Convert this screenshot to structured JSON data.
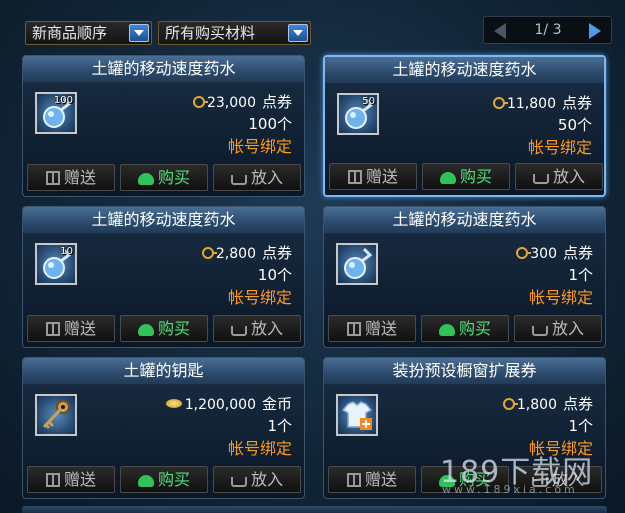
{
  "filters": {
    "sort_label": "新商品顺序",
    "material_label": "所有购买材料"
  },
  "pager": {
    "text": "1/ 3"
  },
  "buttons": {
    "gift": "赠送",
    "buy": "购买",
    "cart": "放入"
  },
  "items": [
    {
      "title": "土罐的移动速度药水",
      "badge": "100",
      "price": "23,000",
      "currency": "点券",
      "count": "100个",
      "bind": "帐号绑定",
      "icon": "potion-icon",
      "selected": false
    },
    {
      "title": "土罐的移动速度药水",
      "badge": "50",
      "price": "11,800",
      "currency": "点券",
      "count": "50个",
      "bind": "帐号绑定",
      "icon": "potion-icon",
      "selected": true
    },
    {
      "title": "土罐的移动速度药水",
      "badge": "10",
      "price": "2,800",
      "currency": "点券",
      "count": "10个",
      "bind": "帐号绑定",
      "icon": "potion-icon",
      "selected": false
    },
    {
      "title": "土罐的移动速度药水",
      "badge": "",
      "price": "300",
      "currency": "点券",
      "count": "1个",
      "bind": "帐号绑定",
      "icon": "potion-icon",
      "selected": false
    },
    {
      "title": "土罐的钥匙",
      "badge": "",
      "price": "1,200,000",
      "currency": "金币",
      "count": "1个",
      "bind": "帐号绑定",
      "icon": "key-icon",
      "selected": false
    },
    {
      "title": "装扮预设橱窗扩展券",
      "badge": "",
      "price": "1,800",
      "currency": "点券",
      "count": "1个",
      "bind": "帐号绑定",
      "icon": "clothes-icon",
      "selected": false
    }
  ],
  "watermark": {
    "text": "189下载网",
    "url": "www.189xia.com"
  },
  "colors": {
    "bind_text": "#ff9a1c",
    "buy_text": "#4fe07a",
    "selected_border": "#7fb7f0"
  }
}
